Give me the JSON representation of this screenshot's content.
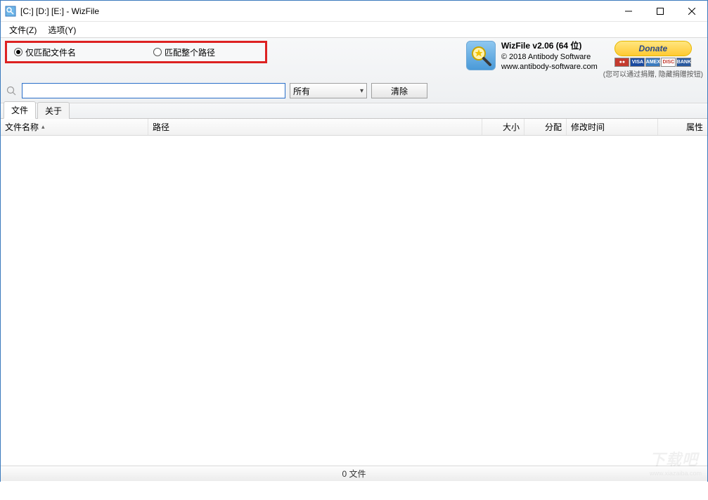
{
  "window": {
    "title": "[C:] [D:] [E:]  - WizFile"
  },
  "menu": {
    "file": "文件(Z)",
    "options": "选项(Y)"
  },
  "toolbar": {
    "radio_filename": "仅匹配文件名",
    "radio_fullpath": "匹配整个路径",
    "search_value": "",
    "filter_selected": "所有",
    "clear_label": "清除"
  },
  "info": {
    "title": "WizFile v2.06 (64 位)",
    "copyright": "© 2018 Antibody Software",
    "url": "www.antibody-software.com",
    "donate": "Donate",
    "hint": "(您可以通过捐赠, 隐藏捐赠按钮)"
  },
  "tabs": {
    "file": "文件",
    "about": "关于"
  },
  "columns": {
    "name": "文件名称",
    "path": "路径",
    "size": "大小",
    "alloc": "分配",
    "mtime": "修改时间",
    "attr": "属性"
  },
  "status": {
    "text": "0 文件"
  },
  "watermark": {
    "big": "下载吧",
    "small": "www.xiazaiba.com"
  }
}
